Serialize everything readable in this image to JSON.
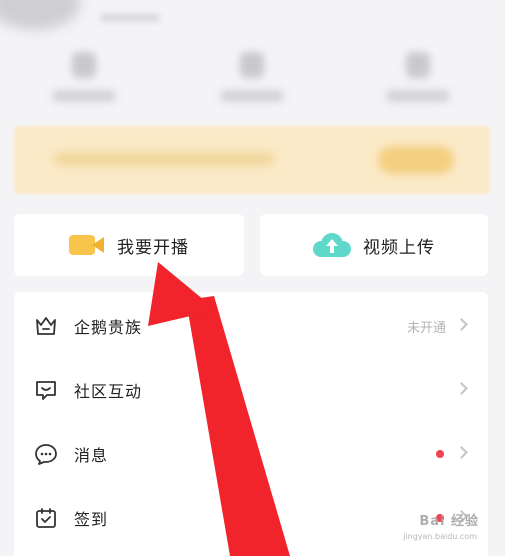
{
  "actions": {
    "live": {
      "label": "我要开播",
      "icon": "video-camera-icon"
    },
    "upload": {
      "label": "视频上传",
      "icon": "cloud-upload-icon"
    }
  },
  "menu": [
    {
      "label": "企鹅贵族",
      "icon": "crown-icon",
      "status": "未开通",
      "red_dot": false
    },
    {
      "label": "社区互动",
      "icon": "chat-bubble-icon",
      "status": "",
      "red_dot": false
    },
    {
      "label": "消息",
      "icon": "message-icon",
      "status": "",
      "red_dot": true
    },
    {
      "label": "签到",
      "icon": "calendar-check-icon",
      "status": "",
      "red_dot": true
    }
  ],
  "watermark": {
    "brand": "Bai 经验",
    "url": "jingyan.baidu.com"
  },
  "colors": {
    "accent_yellow": "#f7c54b",
    "accent_teal": "#5ed8c9",
    "red_dot": "#f0424f",
    "annotation_arrow": "#f1232b",
    "banner": "#fbeac7"
  }
}
